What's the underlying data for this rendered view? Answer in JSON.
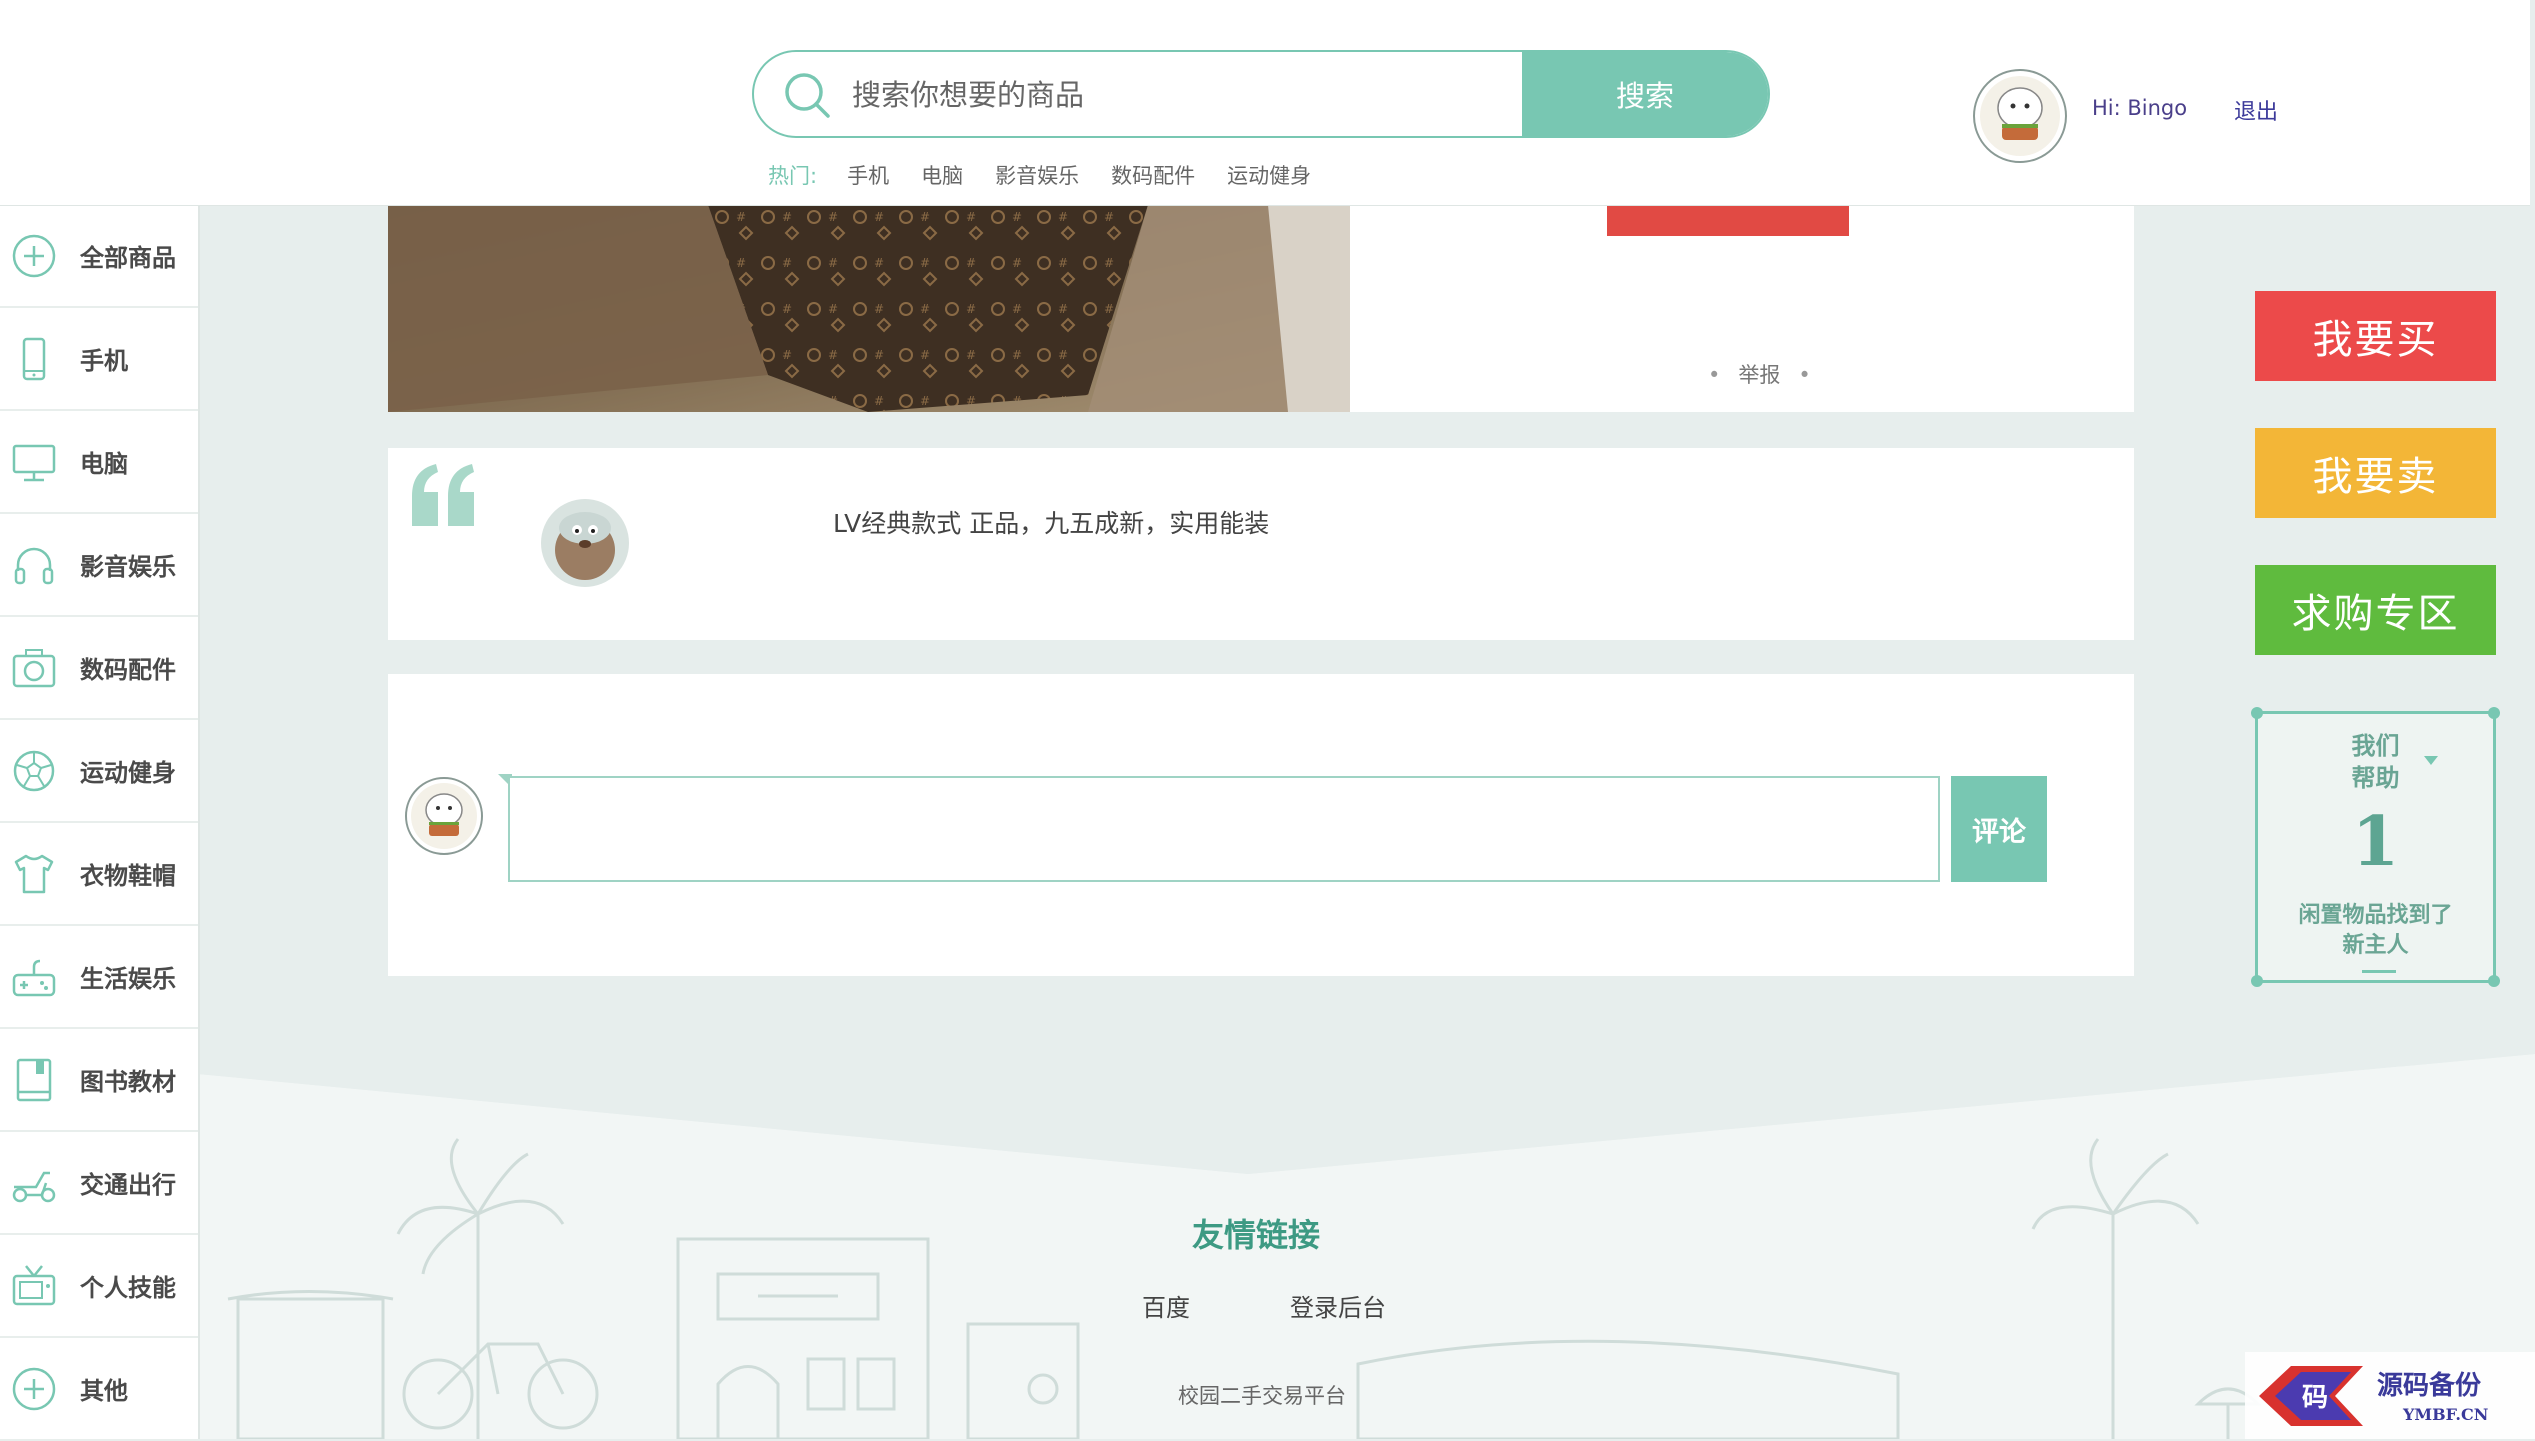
{
  "header": {
    "search_placeholder": "搜索你想要的商品",
    "search_button": "搜索",
    "hot_label": "热门:",
    "hot_items": [
      "手机",
      "电脑",
      "影音娱乐",
      "数码配件",
      "运动健身"
    ],
    "greeting": "Hi: Bingo",
    "logout": "退出"
  },
  "sidebar": {
    "items": [
      {
        "label": "全部商品",
        "icon": "plus-circle-icon"
      },
      {
        "label": "手机",
        "icon": "phone-icon"
      },
      {
        "label": "电脑",
        "icon": "monitor-icon"
      },
      {
        "label": "影音娱乐",
        "icon": "headphones-icon"
      },
      {
        "label": "数码配件",
        "icon": "camera-icon"
      },
      {
        "label": "运动健身",
        "icon": "football-icon"
      },
      {
        "label": "衣物鞋帽",
        "icon": "tshirt-icon"
      },
      {
        "label": "生活娱乐",
        "icon": "gamepad-icon"
      },
      {
        "label": "图书教材",
        "icon": "book-icon"
      },
      {
        "label": "交通出行",
        "icon": "scooter-icon"
      },
      {
        "label": "个人技能",
        "icon": "tv-icon"
      },
      {
        "label": "其他",
        "icon": "plus-circle-icon"
      }
    ]
  },
  "product": {
    "report": "举报"
  },
  "description": {
    "text": "LV经典款式 正品，九五成新，实用能装"
  },
  "comment": {
    "button": "评论",
    "value": ""
  },
  "actions": {
    "buy": "我要买",
    "sell": "我要卖",
    "want": "求购专区"
  },
  "help": {
    "title_line1": "我们",
    "title_line2": "帮助",
    "count": "1",
    "desc_line1": "闲置物品找到了",
    "desc_line2": "新主人"
  },
  "footer": {
    "title": "友情链接",
    "links": [
      "百度",
      "登录后台"
    ],
    "copyright": "校园二手交易平台"
  },
  "watermark": {
    "logo_char": "码",
    "line1": "源码备份",
    "line2": "YMBF.CN"
  },
  "colors": {
    "accent": "#78c7b2",
    "buy": "#ec4a4a",
    "sell": "#f3b637",
    "want": "#5fbb3e"
  }
}
